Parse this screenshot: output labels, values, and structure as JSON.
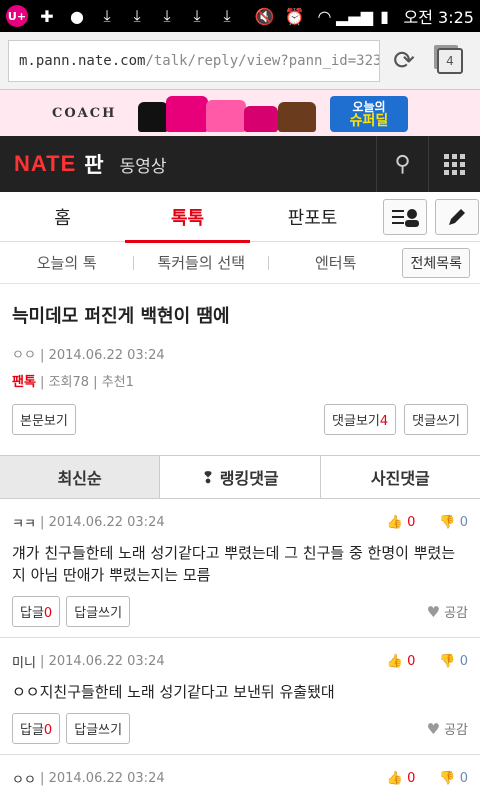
{
  "status": {
    "time": "오전 3:25",
    "carrier_icon": "U+"
  },
  "browser": {
    "url_host": "m.pann.nate.com",
    "url_path": "/talk/reply/view?pann_id=323137",
    "tab_count": "4"
  },
  "ad": {
    "brand": "COACH",
    "cta_line1": "오늘의",
    "cta_line2": "슈퍼딜"
  },
  "appbar": {
    "logo": "NATE",
    "pan": "판",
    "sub": "동영상"
  },
  "mainnav": {
    "tabs": [
      "홈",
      "톡톡",
      "판포토"
    ]
  },
  "subnav": {
    "items": [
      "오늘의 톡",
      "톡커들의 선택",
      "엔터톡"
    ],
    "all_label": "전체목록"
  },
  "post": {
    "title": "늑미데모 퍼진게 백현이 땜에",
    "author": "ㅇㅇ",
    "date": "2014.06.22 03:24",
    "category": "팬톡",
    "views": "조회78",
    "recommend": "추천1",
    "view_body": "본문보기",
    "view_comments": "댓글보기",
    "comment_count": "4",
    "write_comment": "댓글쓰기"
  },
  "sort": {
    "tabs": [
      "최신순",
      "랭킹댓글",
      "사진댓글"
    ]
  },
  "comments": [
    {
      "author": "ㅋㅋ",
      "date": "2014.06.22 03:24",
      "up": "0",
      "down": "0",
      "body": "걔가 친구들한테 노래 성기같다고 뿌렸는데 그 친구들 중 한명이 뿌렸는지 아님 딴애가 뿌렸는지는 모름",
      "reply": "답글",
      "reply_count": "0",
      "write_reply": "답글쓰기",
      "like": "공감"
    },
    {
      "author": "미니",
      "date": "2014.06.22 03:24",
      "up": "0",
      "down": "0",
      "body": "ㅇㅇ지친구들한테 노래 성기같다고 보낸뒤 유출됐대",
      "reply": "답글",
      "reply_count": "0",
      "write_reply": "답글쓰기",
      "like": "공감"
    },
    {
      "author": "ㅇㅇ",
      "date": "2014.06.22 03:24",
      "up": "0",
      "down": "0"
    }
  ]
}
